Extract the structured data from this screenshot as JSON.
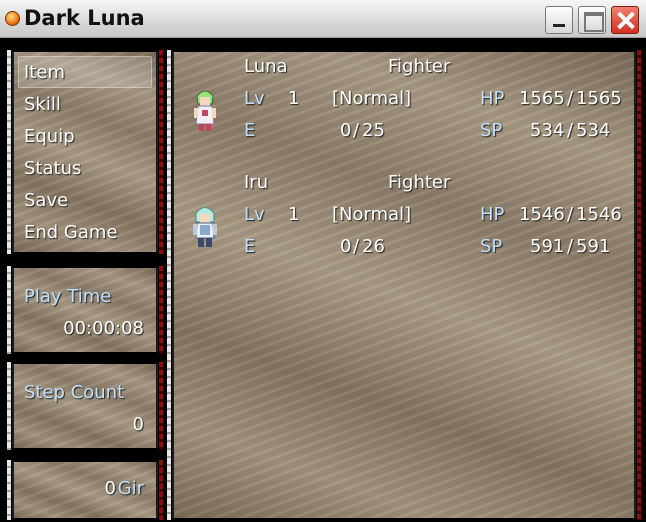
{
  "window": {
    "title": "Dark Luna"
  },
  "menu": {
    "items": [
      {
        "label": "Item"
      },
      {
        "label": "Skill"
      },
      {
        "label": "Equip"
      },
      {
        "label": "Status"
      },
      {
        "label": "Save"
      },
      {
        "label": "End Game"
      }
    ],
    "selected_index": 0
  },
  "playtime": {
    "label": "Play Time",
    "value": "00:00:08"
  },
  "steps": {
    "label": "Step Count",
    "value": "0"
  },
  "gold": {
    "value": "0",
    "unit": "Gir"
  },
  "party": [
    {
      "name": "Luna",
      "class": "Fighter",
      "lv_label": "Lv",
      "level": "1",
      "state": "[Normal]",
      "hp_label": "HP",
      "hp": "1565",
      "hp_max": "1565",
      "exp_label": "E",
      "exp": "0",
      "exp_next": "25",
      "sp_label": "SP",
      "sp": "534",
      "sp_max": "534",
      "sprite": "luna-sprite"
    },
    {
      "name": "Iru",
      "class": "Fighter",
      "lv_label": "Lv",
      "level": "1",
      "state": "[Normal]",
      "hp_label": "HP",
      "hp": "1546",
      "hp_max": "1546",
      "exp_label": "E",
      "exp": "0",
      "exp_next": "26",
      "sp_label": "SP",
      "sp": "591",
      "sp_max": "591",
      "sprite": "iru-sprite"
    }
  ],
  "colors": {
    "system_text": "#c0e0f8",
    "normal_text": "#ffffff"
  }
}
